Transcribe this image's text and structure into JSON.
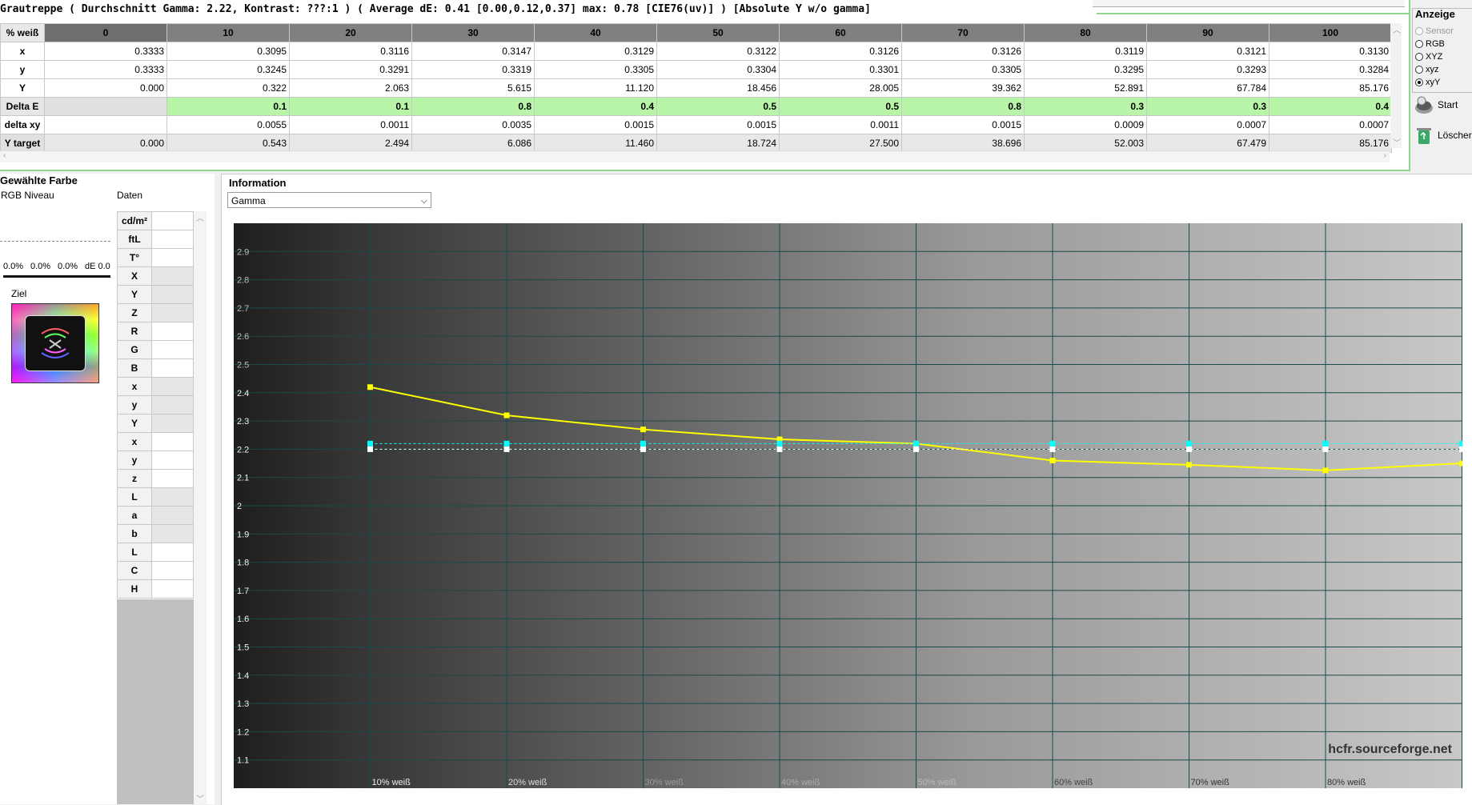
{
  "title": "Grautreppe ( Durchschnitt Gamma: 2.22, Kontrast: ???:1 ) ( Average dE: 0.41 [0.00,0.12,0.37] max: 0.78 [CIE76(uv)] ) [Absolute Y w/o gamma]",
  "table": {
    "corner": "% weiß",
    "columns": [
      "0",
      "10",
      "20",
      "30",
      "40",
      "50",
      "60",
      "70",
      "80",
      "90",
      "100"
    ],
    "rows": [
      {
        "label": "x",
        "values": [
          "0.3333",
          "0.3095",
          "0.3116",
          "0.3147",
          "0.3129",
          "0.3122",
          "0.3126",
          "0.3126",
          "0.3119",
          "0.3121",
          "0.3130"
        ]
      },
      {
        "label": "y",
        "values": [
          "0.3333",
          "0.3245",
          "0.3291",
          "0.3319",
          "0.3305",
          "0.3304",
          "0.3301",
          "0.3305",
          "0.3295",
          "0.3293",
          "0.3284"
        ]
      },
      {
        "label": "Y",
        "values": [
          "0.000",
          "0.322",
          "2.063",
          "5.615",
          "11.120",
          "18.456",
          "28.005",
          "39.362",
          "52.891",
          "67.784",
          "85.176"
        ]
      },
      {
        "label": "Delta E",
        "values": [
          "",
          "0.1",
          "0.1",
          "0.8",
          "0.4",
          "0.5",
          "0.5",
          "0.8",
          "0.3",
          "0.3",
          "0.4"
        ]
      },
      {
        "label": "delta xy",
        "values": [
          "",
          "0.0055",
          "0.0011",
          "0.0035",
          "0.0015",
          "0.0015",
          "0.0011",
          "0.0015",
          "0.0009",
          "0.0007",
          "0.0007"
        ]
      },
      {
        "label": "Y target",
        "values": [
          "0.000",
          "0.543",
          "2.494",
          "6.086",
          "11.460",
          "18.724",
          "27.500",
          "38.696",
          "52.003",
          "67.479",
          "85.176"
        ]
      }
    ]
  },
  "anzeige": {
    "title": "Anzeige",
    "options": [
      {
        "label": "Sensor",
        "selected": false,
        "disabled": true
      },
      {
        "label": "RGB",
        "selected": false,
        "disabled": false
      },
      {
        "label": "XYZ",
        "selected": false,
        "disabled": false
      },
      {
        "label": "xyz",
        "selected": false,
        "disabled": false
      },
      {
        "label": "xyY",
        "selected": true,
        "disabled": false
      }
    ],
    "start_label": "Start",
    "loeschen_label": "Löscher"
  },
  "left": {
    "title": "Gewählte Farbe",
    "rgb_label": "RGB Niveau",
    "daten_label": "Daten",
    "pct_r": "0.0%",
    "pct_g": "0.0%",
    "pct_b": "0.0%",
    "de": "dE 0.0",
    "ziel_label": "Ziel",
    "daten_rows": [
      "cd/m²",
      "ftL",
      "T°",
      "X",
      "Y",
      "Z",
      "R",
      "G",
      "B",
      "x",
      "y",
      "Y",
      "x",
      "y",
      "z",
      "L",
      "a",
      "b",
      "L",
      "C",
      "H"
    ]
  },
  "info": {
    "title": "Information",
    "select_value": "Gamma",
    "watermark": "hcfr.sourceforge.net"
  },
  "chart_data": {
    "type": "line",
    "x": [
      0,
      10,
      20,
      30,
      40,
      50,
      60,
      70,
      80,
      90
    ],
    "x_tick_labels": [
      "10% weiß",
      "20% weiß",
      "30% weiß",
      "40% weiß",
      "50% weiß",
      "60% weiß",
      "70% weiß",
      "80% weiß"
    ],
    "y_ticks": [
      "2.9",
      "2.8",
      "2.7",
      "2.6",
      "2.5",
      "2.4",
      "2.3",
      "2.2",
      "2.1",
      "2",
      "1.9",
      "1.8",
      "1.7",
      "1.6",
      "1.5",
      "1.4",
      "1.3",
      "1.2",
      "1.1"
    ],
    "ylim": [
      1.0,
      3.0
    ],
    "series": [
      {
        "color": "#ffff00",
        "points": [
          [
            10,
            2.42
          ],
          [
            20,
            2.32
          ],
          [
            30,
            2.27
          ],
          [
            40,
            2.235
          ],
          [
            50,
            2.22
          ],
          [
            60,
            2.16
          ],
          [
            70,
            2.145
          ],
          [
            80,
            2.125
          ],
          [
            90,
            2.15
          ]
        ]
      },
      {
        "color": "#00ffff",
        "dashed": true,
        "points": [
          [
            10,
            2.22
          ],
          [
            20,
            2.22
          ],
          [
            30,
            2.22
          ],
          [
            40,
            2.22
          ],
          [
            50,
            2.22
          ],
          [
            60,
            2.22
          ],
          [
            70,
            2.22
          ],
          [
            80,
            2.22
          ],
          [
            90,
            2.22
          ]
        ]
      },
      {
        "color": "#ffffff",
        "dashed": true,
        "points": [
          [
            10,
            2.2
          ],
          [
            20,
            2.2
          ],
          [
            30,
            2.2
          ],
          [
            40,
            2.2
          ],
          [
            50,
            2.2
          ],
          [
            60,
            2.2
          ],
          [
            70,
            2.2
          ],
          [
            80,
            2.2
          ],
          [
            90,
            2.2
          ]
        ]
      }
    ],
    "grid": true
  },
  "colors": {
    "delta_green": "#b8f5a8",
    "panel_border": "#8fd48f"
  }
}
